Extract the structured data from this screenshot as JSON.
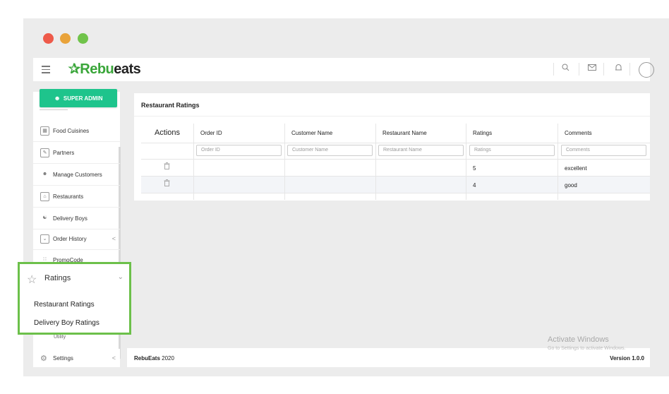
{
  "header": {
    "logo_text_1": "Rebu",
    "logo_text_2": "eats",
    "logo_star": "✰",
    "search_icon": "search-icon",
    "mail_icon": "mail-icon",
    "bell_icon": "bell-icon"
  },
  "sidebar": {
    "admin_label": "SUPER ADMIN",
    "items": [
      {
        "label": "Food Cuisines",
        "icon": "grid-icon"
      },
      {
        "label": "Partners",
        "icon": "edit-icon"
      },
      {
        "label": "Manage Customers",
        "icon": "user-icon"
      },
      {
        "label": "Restaurants",
        "icon": "store-icon"
      },
      {
        "label": "Delivery Boys",
        "icon": "users-icon"
      },
      {
        "label": "Order History",
        "icon": "inbox-icon",
        "chevron": "<"
      },
      {
        "label": "PromoCode",
        "icon": "dots-icon"
      }
    ],
    "utility_label": "Utility",
    "settings_label": "Settings",
    "settings_chevron": "<"
  },
  "ratings_menu": {
    "title": "Ratings",
    "chevron": "⌄",
    "sub_items": [
      "Restaurant Ratings",
      "Delivery Boy Ratings"
    ]
  },
  "main": {
    "title": "Restaurant Ratings",
    "columns": [
      "Actions",
      "Order ID",
      "Customer Name",
      "Restaurant Name",
      "Ratings",
      "Comments"
    ],
    "filters": [
      "Order ID",
      "Customer Name",
      "Restaurant Name",
      "Ratings",
      "Comments"
    ],
    "rows": [
      {
        "order_id": "",
        "customer": "",
        "restaurant": "",
        "rating": "5",
        "comment": "excellent"
      },
      {
        "order_id": "",
        "customer": "",
        "restaurant": "",
        "rating": "4",
        "comment": "good"
      }
    ]
  },
  "footer": {
    "brand": "RebuEats",
    "year": "2020",
    "version": "Version 1.0.0"
  },
  "watermark": {
    "line1": "Activate Windows",
    "line2": "Go to Settings to activate Windows."
  },
  "colors": {
    "accent": "#1ec48c",
    "highlight_border": "#6cc04a",
    "logo_green": "#3aa63a"
  }
}
